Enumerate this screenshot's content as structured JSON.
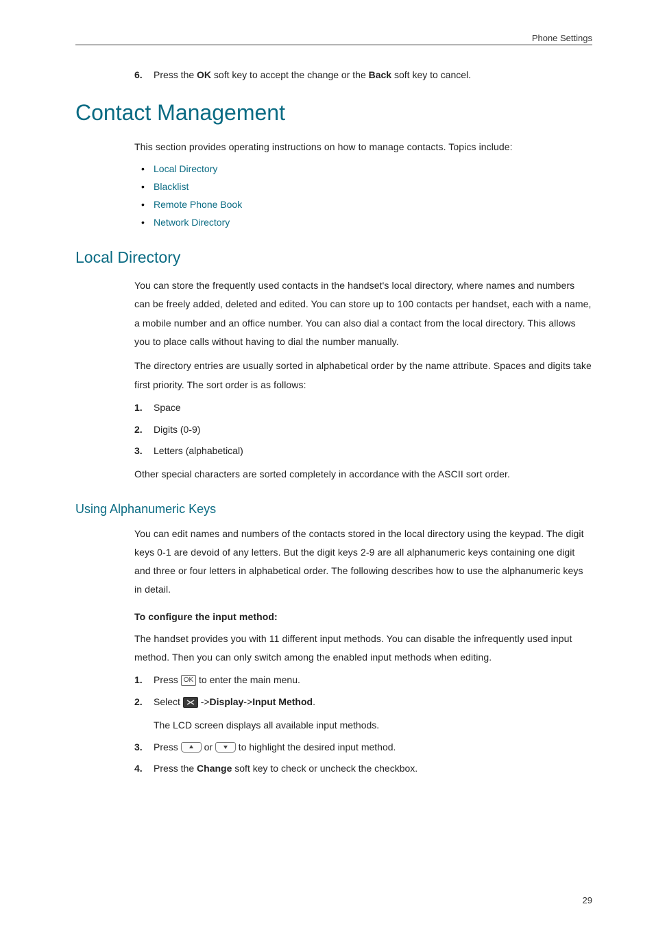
{
  "header": {
    "section": "Phone Settings"
  },
  "step6": {
    "num": "6.",
    "prefix": "Press the ",
    "key1": "OK",
    "mid": " soft key to accept the change or the ",
    "key2": "Back",
    "suffix": " soft key to cancel."
  },
  "h1": "Contact Management",
  "intro": "This section provides operating instructions on how to manage contacts. Topics include:",
  "links": [
    "Local Directory",
    "Blacklist",
    "Remote Phone Book",
    "Network Directory"
  ],
  "h2": "Local Directory",
  "ld_para1": "You can store the frequently used contacts in the handset's local directory, where names and numbers can be freely added, deleted and edited. You can store up to 100 contacts per handset, each with a name, a mobile number and an office number. You can also dial a contact from the local directory. This allows you to place calls without having to dial the number manually.",
  "ld_para2": "The directory entries are usually sorted in alphabetical order by the name attribute. Spaces and digits take first priority. The sort order is as follows:",
  "sort_list": [
    {
      "n": "1.",
      "t": "Space"
    },
    {
      "n": "2.",
      "t": "Digits (0-9)"
    },
    {
      "n": "3.",
      "t": "Letters (alphabetical)"
    }
  ],
  "ld_para3": "Other special characters are sorted completely in accordance with the ASCII sort order.",
  "h3": "Using Alphanumeric Keys",
  "ak_para1": "You can edit names and numbers of the contacts stored in the local directory using the keypad. The digit keys 0-1 are devoid of any letters. But the digit keys 2-9 are all alphanumeric keys containing one digit and three or four letters in alphabetical order. The following describes how to use the alphanumeric keys in detail.",
  "config_head": "To configure the input method:",
  "ak_para2": "The handset provides you with 11 different input methods. You can disable the infrequently used input method. Then you can only switch among the enabled input methods when editing.",
  "steps": {
    "s1": {
      "n": "1.",
      "a": "Press ",
      "ok": "OK",
      "b": " to enter the main menu."
    },
    "s2": {
      "n": "2.",
      "a": "Select ",
      "arrow": " ->",
      "disp": "Display",
      "arrow2": "->",
      "im": "Input Method",
      "dot": "."
    },
    "s2_sub": "The LCD screen displays all available input methods.",
    "s3": {
      "n": "3.",
      "a": "Press ",
      "mid": " or ",
      "b": " to highlight the desired input method."
    },
    "s4": {
      "n": "4.",
      "a": "Press the ",
      "chg": "Change",
      "b": " soft key to check or uncheck the checkbox."
    }
  },
  "page_num": "29"
}
